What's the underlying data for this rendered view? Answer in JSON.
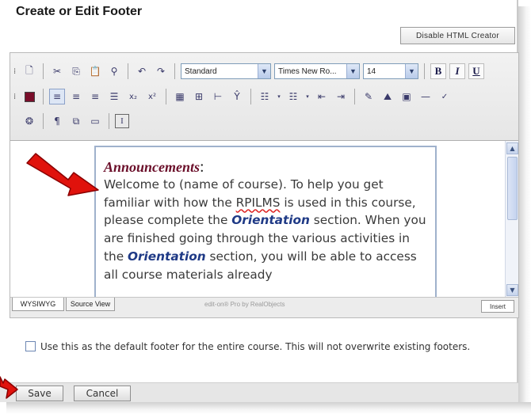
{
  "page": {
    "title": "Create or Edit Footer",
    "disable_button": "Disable HTML Creator"
  },
  "toolbar": {
    "style_select": "Standard",
    "font_select": "Times New Ro...",
    "size_select": "14",
    "bold_label": "B",
    "italic_label": "I",
    "underline_label": "U"
  },
  "editor": {
    "heading": "Announcements",
    "heading_colon": ":",
    "body": {
      "p1": "Welcome to (name of course). To help you get familiar with how the ",
      "rpilms": "RPILMS",
      "p2": " is used in this course, please complete the ",
      "orientation1": "Orientation",
      "p3": " section. When you are finished going through the various activities in the ",
      "orientation2": "Orientation",
      "p4": " section, you will be able to access all course materials already"
    }
  },
  "tabs": {
    "wysiwyg": "WYSIWYG",
    "source": "Source View",
    "powered_by": "edit-on® Pro by RealObjects",
    "insert": "Insert"
  },
  "footer_option": {
    "label": "Use this as the default footer for the entire course. This will not overwrite existing footers."
  },
  "buttons": {
    "save": "Save",
    "cancel": "Cancel"
  },
  "colors": {
    "heading": "#6b0f2a",
    "link_word": "#1f3a86",
    "annotation_arrow": "#e0120c"
  },
  "icons": {
    "row1": [
      "grip-icon",
      "new-document-icon",
      "cut-icon",
      "copy-icon",
      "paste-icon",
      "find-icon",
      "undo-icon",
      "redo-icon"
    ],
    "row2": [
      "grip-icon",
      "text-color-icon",
      "align-left-icon",
      "align-center-icon",
      "align-right-icon",
      "justify-icon",
      "subscript-icon",
      "superscript-icon",
      "table-icon",
      "insert-row-icon",
      "split-cell-icon",
      "merge-cell-icon",
      "bulleted-list-icon",
      "numbered-list-icon",
      "outdent-icon",
      "indent-icon",
      "hyperlink-icon",
      "image-icon",
      "media-icon",
      "horizontal-rule-icon",
      "spellcheck-icon"
    ],
    "row3": [
      "special-char-icon",
      "paragraph-mark-icon",
      "show-borders-icon",
      "frame-icon",
      "properties-icon"
    ]
  }
}
